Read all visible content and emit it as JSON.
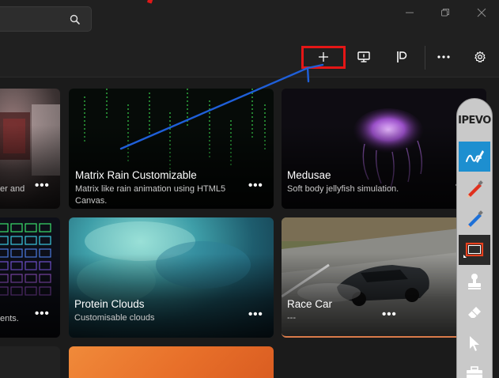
{
  "search": {
    "placeholder": ""
  },
  "toolbar": {
    "add_icon": "plus-icon",
    "monitor_icon": "monitor-icon",
    "pin_icon": "pin-icon",
    "more_icon": "more-icon",
    "settings_icon": "gear-icon"
  },
  "tiles": [
    {
      "title": "",
      "description": "er and",
      "more": "•••"
    },
    {
      "title": "Matrix Rain Customizable",
      "description": "Matrix like rain animation using HTML5 Canvas.",
      "more": "•••"
    },
    {
      "title": "Medusae",
      "description": "Soft body jellyfish simulation.",
      "more": "•••"
    },
    {
      "title": "",
      "description": "ents.",
      "more": "•••"
    },
    {
      "title": "Protein Clouds",
      "description": "Customisable clouds",
      "more": "•••"
    },
    {
      "title": "Race Car",
      "description": "---",
      "more": "•••"
    }
  ],
  "ipevo": {
    "logo": "IPEVO",
    "tools": [
      "handwriting-icon",
      "red-pen-icon",
      "blue-pen-icon",
      "rectangle-icon",
      "stamp-icon",
      "eraser-icon",
      "cursor-icon",
      "toolbox-icon"
    ]
  },
  "colors": {
    "background": "#202020",
    "highlight_box": "#e51616",
    "annotation_arrow": "#1f5fd8",
    "ipevo_active": "#1d8fd0"
  }
}
